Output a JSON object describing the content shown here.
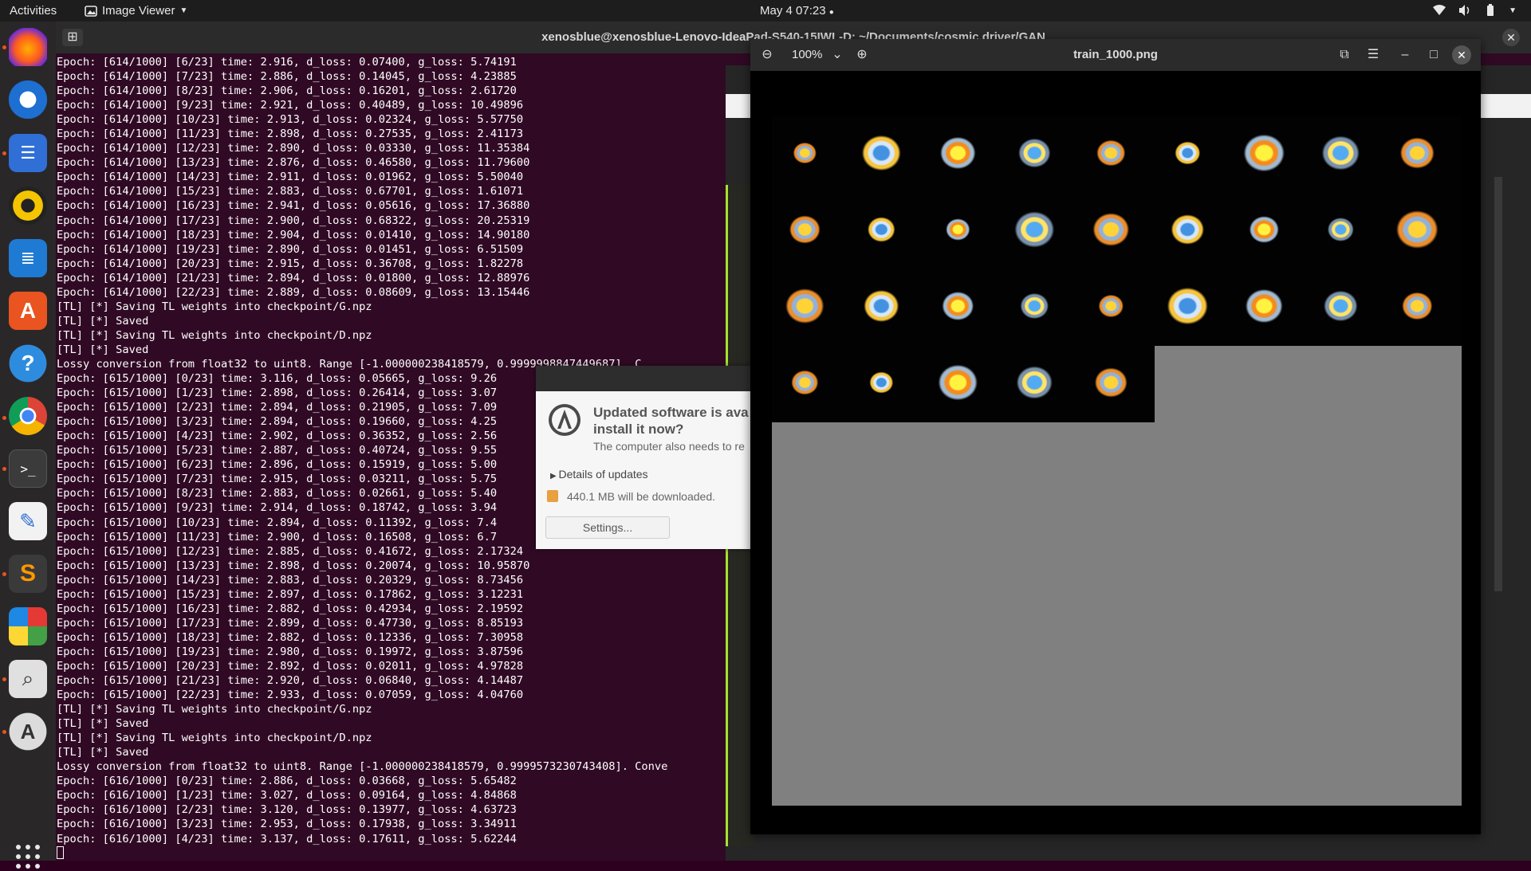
{
  "topbar": {
    "activities": "Activities",
    "app_name": "Image Viewer",
    "clock": "May 4  07:23"
  },
  "dock": {
    "items": [
      "firefox-icon",
      "thunderbird-icon",
      "files-icon",
      "rhythmbox-icon",
      "writer-icon",
      "software-center-icon",
      "help-icon",
      "chrome-icon",
      "terminal-icon",
      "text-editor-icon",
      "sublime-icon",
      "puzzle-icon",
      "image-viewer-icon",
      "update-manager-icon"
    ],
    "apps_grid": "show-applications-icon"
  },
  "terminal": {
    "title": "xenosblue@xenosblue-Lenovo-IdeaPad-S540-15IWL-D: ~/Documents/cosmic.driver/GAN",
    "lines": [
      "Epoch: [614/1000] [6/23] time: 2.916, d_loss: 0.07400, g_loss: 5.74191",
      "Epoch: [614/1000] [7/23] time: 2.886, d_loss: 0.14045, g_loss: 4.23885",
      "Epoch: [614/1000] [8/23] time: 2.906, d_loss: 0.16201, g_loss: 2.61720",
      "Epoch: [614/1000] [9/23] time: 2.921, d_loss: 0.40489, g_loss: 10.49896",
      "Epoch: [614/1000] [10/23] time: 2.913, d_loss: 0.02324, g_loss: 5.57750",
      "Epoch: [614/1000] [11/23] time: 2.898, d_loss: 0.27535, g_loss: 2.41173",
      "Epoch: [614/1000] [12/23] time: 2.890, d_loss: 0.03330, g_loss: 11.35384",
      "Epoch: [614/1000] [13/23] time: 2.876, d_loss: 0.46580, g_loss: 11.79600",
      "Epoch: [614/1000] [14/23] time: 2.911, d_loss: 0.01962, g_loss: 5.50040",
      "Epoch: [614/1000] [15/23] time: 2.883, d_loss: 0.67701, g_loss: 1.61071",
      "Epoch: [614/1000] [16/23] time: 2.941, d_loss: 0.05616, g_loss: 17.36880",
      "Epoch: [614/1000] [17/23] time: 2.900, d_loss: 0.68322, g_loss: 20.25319",
      "Epoch: [614/1000] [18/23] time: 2.904, d_loss: 0.01410, g_loss: 14.90180",
      "Epoch: [614/1000] [19/23] time: 2.890, d_loss: 0.01451, g_loss: 6.51509",
      "Epoch: [614/1000] [20/23] time: 2.915, d_loss: 0.36708, g_loss: 1.82278",
      "Epoch: [614/1000] [21/23] time: 2.894, d_loss: 0.01800, g_loss: 12.88976",
      "Epoch: [614/1000] [22/23] time: 2.889, d_loss: 0.08609, g_loss: 13.15446",
      "[TL] [*] Saving TL weights into checkpoint/G.npz",
      "[TL] [*] Saved",
      "[TL] [*] Saving TL weights into checkpoint/D.npz",
      "[TL] [*] Saved",
      "Lossy conversion from float32 to uint8. Range [-1.000000238418579, 0.9999998847449687]. C",
      "Epoch: [615/1000] [0/23] time: 3.116, d_loss: 0.05665, g_loss: 9.26",
      "Epoch: [615/1000] [1/23] time: 2.898, d_loss: 0.26414, g_loss: 3.07",
      "Epoch: [615/1000] [2/23] time: 2.894, d_loss: 0.21905, g_loss: 7.09",
      "Epoch: [615/1000] [3/23] time: 2.894, d_loss: 0.19660, g_loss: 4.25",
      "Epoch: [615/1000] [4/23] time: 2.902, d_loss: 0.36352, g_loss: 2.56",
      "Epoch: [615/1000] [5/23] time: 2.887, d_loss: 0.40724, g_loss: 9.55",
      "Epoch: [615/1000] [6/23] time: 2.896, d_loss: 0.15919, g_loss: 5.00",
      "Epoch: [615/1000] [7/23] time: 2.915, d_loss: 0.03211, g_loss: 5.75",
      "Epoch: [615/1000] [8/23] time: 2.883, d_loss: 0.02661, g_loss: 5.40",
      "Epoch: [615/1000] [9/23] time: 2.914, d_loss: 0.18742, g_loss: 3.94",
      "Epoch: [615/1000] [10/23] time: 2.894, d_loss: 0.11392, g_loss: 7.4",
      "Epoch: [615/1000] [11/23] time: 2.900, d_loss: 0.16508, g_loss: 6.7",
      "Epoch: [615/1000] [12/23] time: 2.885, d_loss: 0.41672, g_loss: 2.17324",
      "Epoch: [615/1000] [13/23] time: 2.898, d_loss: 0.20074, g_loss: 10.95870",
      "Epoch: [615/1000] [14/23] time: 2.883, d_loss: 0.20329, g_loss: 8.73456",
      "Epoch: [615/1000] [15/23] time: 2.897, d_loss: 0.17862, g_loss: 3.12231",
      "Epoch: [615/1000] [16/23] time: 2.882, d_loss: 0.42934, g_loss: 2.19592",
      "Epoch: [615/1000] [17/23] time: 2.899, d_loss: 0.47730, g_loss: 8.85193",
      "Epoch: [615/1000] [18/23] time: 2.882, d_loss: 0.12336, g_loss: 7.30958",
      "Epoch: [615/1000] [19/23] time: 2.980, d_loss: 0.19972, g_loss: 3.87596",
      "Epoch: [615/1000] [20/23] time: 2.892, d_loss: 0.02011, g_loss: 4.97828",
      "Epoch: [615/1000] [21/23] time: 2.920, d_loss: 0.06840, g_loss: 4.14487",
      "Epoch: [615/1000] [22/23] time: 2.933, d_loss: 0.07059, g_loss: 4.04760",
      "[TL] [*] Saving TL weights into checkpoint/G.npz",
      "[TL] [*] Saved",
      "[TL] [*] Saving TL weights into checkpoint/D.npz",
      "[TL] [*] Saved",
      "Lossy conversion from float32 to uint8. Range [-1.000000238418579, 0.9999573230743408]. Conve",
      "Epoch: [616/1000] [0/23] time: 2.886, d_loss: 0.03668, g_loss: 5.65482",
      "Epoch: [616/1000] [1/23] time: 3.027, d_loss: 0.09164, g_loss: 4.84868",
      "Epoch: [616/1000] [2/23] time: 3.120, d_loss: 0.13977, g_loss: 4.63723",
      "Epoch: [616/1000] [3/23] time: 2.953, d_loss: 0.17938, g_loss: 3.34911",
      "Epoch: [616/1000] [4/23] time: 3.137, d_loss: 0.17611, g_loss: 5.62244"
    ]
  },
  "update_dialog": {
    "heading_line1": "Updated software is ava",
    "heading_line2": "install it now?",
    "subtext": "The computer also needs to re",
    "details": "Details of updates",
    "size": "440.1 MB will be downloaded.",
    "settings_button": "Settings..."
  },
  "image_viewer": {
    "zoom": "100%",
    "title": "train_1000.png",
    "sprite_count": 32
  },
  "colors": {
    "terminal_bg": "#300a24",
    "accent": "#e95420"
  }
}
